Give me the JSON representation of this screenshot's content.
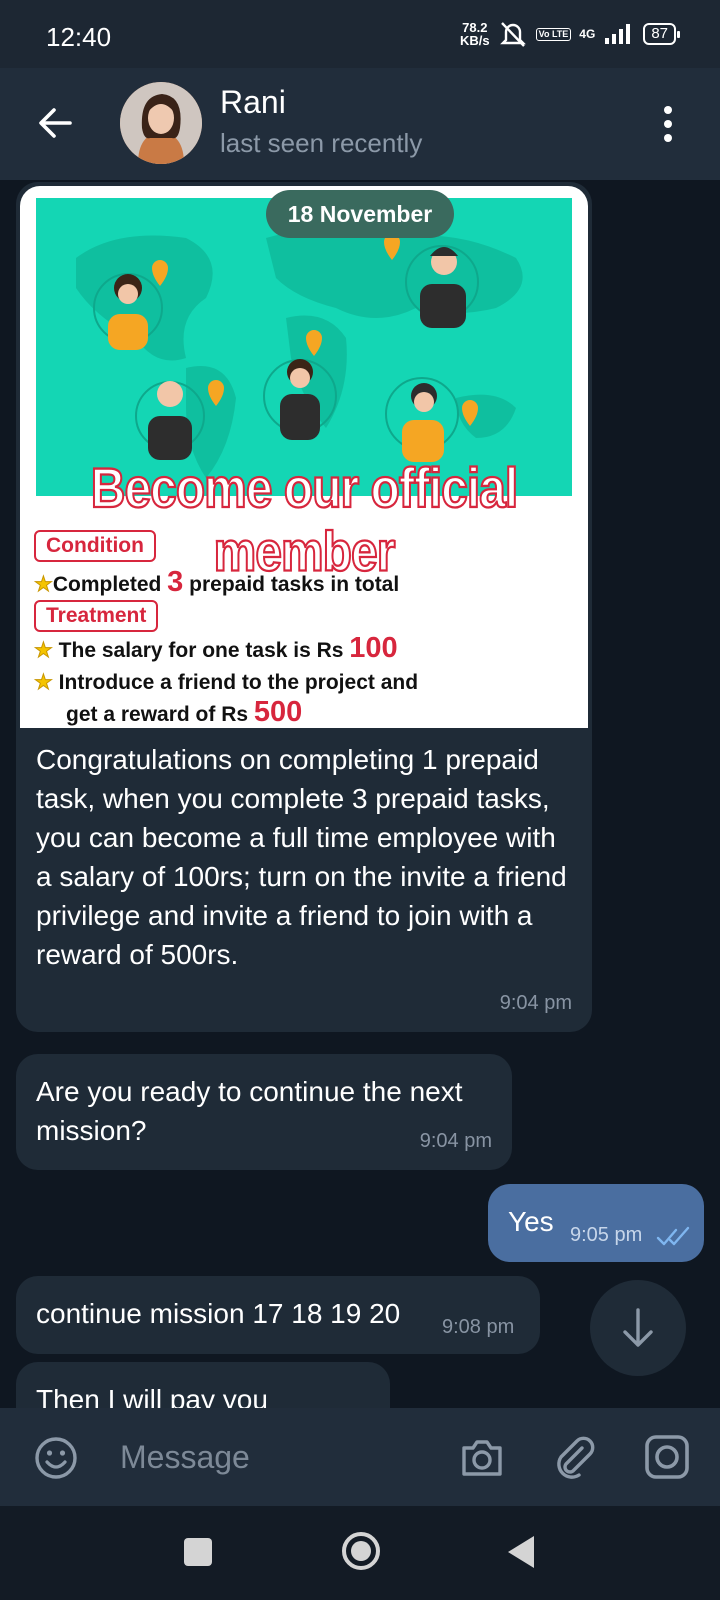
{
  "status_bar": {
    "time": "12:40",
    "speed_value": "78.2",
    "speed_unit": "KB/s",
    "volte": "Vo LTE",
    "network": "4G",
    "battery": "87"
  },
  "header": {
    "contact_name": "Rani",
    "status": "last seen recently"
  },
  "date_chip": "18 November",
  "promo_image": {
    "headline": "Become our official member",
    "condition_tag": "Condition",
    "condition_pre": "Completed ",
    "condition_num": "3",
    "condition_post": " prepaid tasks in total",
    "treatment_tag": "Treatment",
    "salary_pre": "The salary for one task is Rs ",
    "salary_num": "100",
    "invite_line1": "Introduce a friend to the project and",
    "invite_line2_pre": "get a reward of Rs ",
    "invite_num": "500",
    "colors": {
      "map_bg": "#14d6b4",
      "accent_red": "#d7263d"
    }
  },
  "messages": [
    {
      "direction": "in",
      "text": "Congratulations on completing 1 prepaid task, when you complete 3 prepaid tasks, you can become a full time employee with a salary of 100rs; turn on the invite a friend privilege and invite a friend to join with a reward of 500rs.",
      "time": "9:04 pm"
    },
    {
      "direction": "in",
      "text": "Are you ready to continue the next mission?",
      "time": "9:04 pm"
    },
    {
      "direction": "out",
      "text": "Yes",
      "time": "9:05 pm",
      "status_icon": "double-check-icon"
    },
    {
      "direction": "in",
      "text": "continue mission 17 18 19 20",
      "time": "9:08 pm"
    },
    {
      "direction": "in",
      "text": "Then I will pay you",
      "time": ""
    }
  ],
  "input": {
    "placeholder": "Message"
  },
  "icons": {
    "back": "arrow-left-icon",
    "menu": "more-vertical-icon",
    "emoji": "emoji-icon",
    "camera": "camera-icon",
    "attach": "paperclip-icon",
    "video": "video-message-icon",
    "scroll_down": "arrow-down-icon"
  },
  "colors": {
    "chat_bg": "#0f1721",
    "header_bg": "#212d3b",
    "incoming_bubble": "#1f2b37",
    "outgoing_bubble": "#4a6ea0",
    "read_check": "#7fb6f0"
  }
}
